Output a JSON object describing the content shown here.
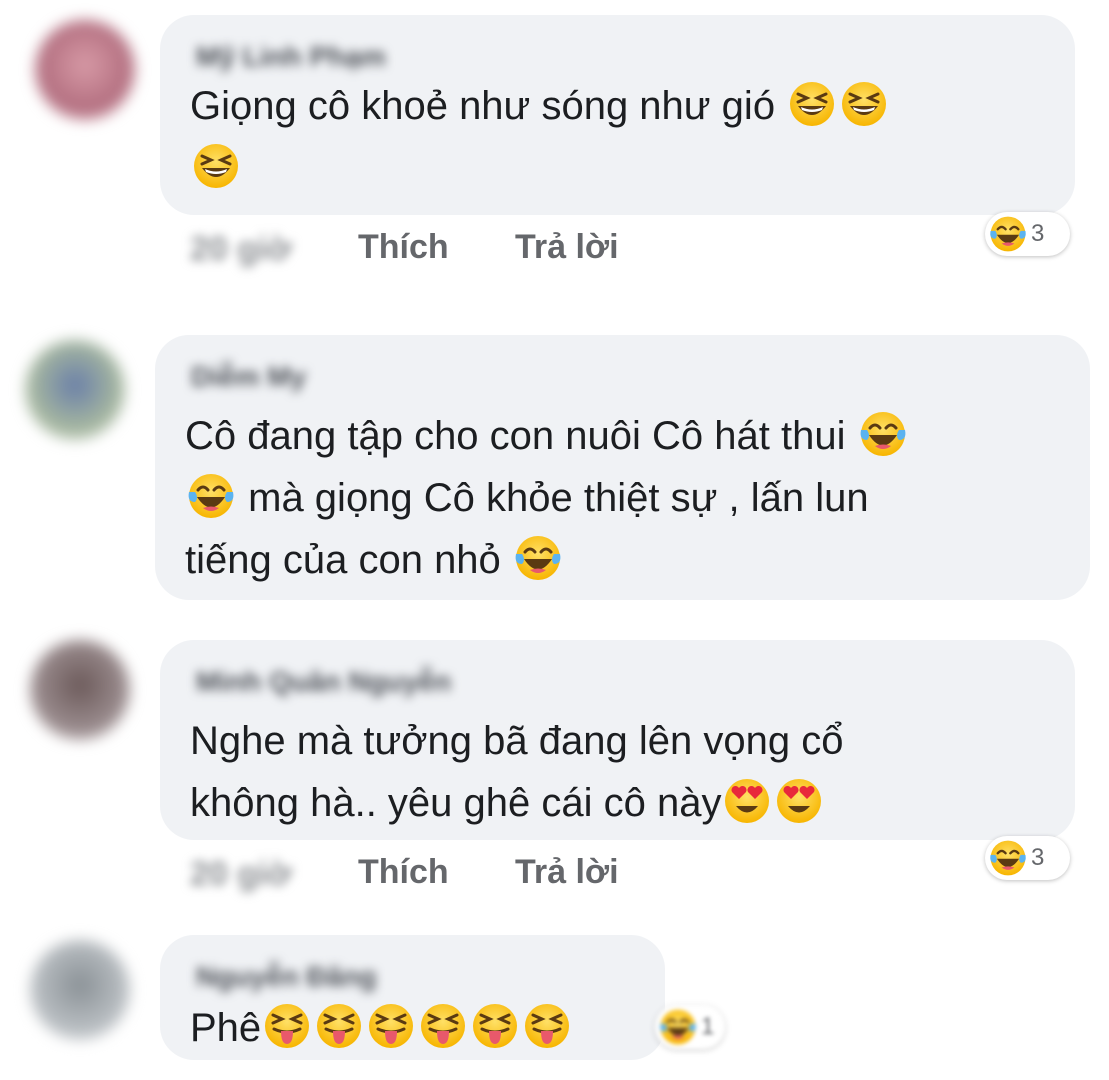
{
  "comments": [
    {
      "author": "Mỹ Linh Phạm",
      "lines": [
        "Giọng cô khoẻ như sóng như gió",
        ""
      ],
      "emojis": [
        "squint-laugh",
        "squint-laugh",
        "squint-laugh"
      ],
      "time": "20 giờ",
      "like_label": "Thích",
      "reply_label": "Trả lời",
      "reaction_count": "3"
    },
    {
      "author": "Diễm My",
      "lines": [
        "Cô đang tập cho con nuôi Cô hát thui",
        "mà giọng Cô khỏe thiệt sự , lấn lun",
        "tiếng của con nhỏ"
      ],
      "emojis": [
        "tears-of-joy",
        "tears-of-joy",
        "tears-of-joy"
      ]
    },
    {
      "author": "Minh Quân Nguyễn",
      "lines": [
        "Nghe mà tưởng bã đang lên vọng cổ",
        "không hà.. yêu ghê cái cô này"
      ],
      "emojis": [
        "heart-eyes",
        "heart-eyes"
      ],
      "time": "20 giờ",
      "like_label": "Thích",
      "reply_label": "Trả lời",
      "reaction_count": "3"
    },
    {
      "author": "Nguyễn Đăng",
      "lines": [
        "Phê"
      ],
      "emojis": [
        "tongue-squint",
        "tongue-squint",
        "tongue-squint",
        "tongue-squint",
        "tongue-squint",
        "tongue-squint"
      ],
      "reaction_count": "1"
    }
  ],
  "colors": {
    "bubble": "#f0f2f5",
    "text": "#1c1e21",
    "meta": "#65676b",
    "emoji": "#ffcc33"
  }
}
